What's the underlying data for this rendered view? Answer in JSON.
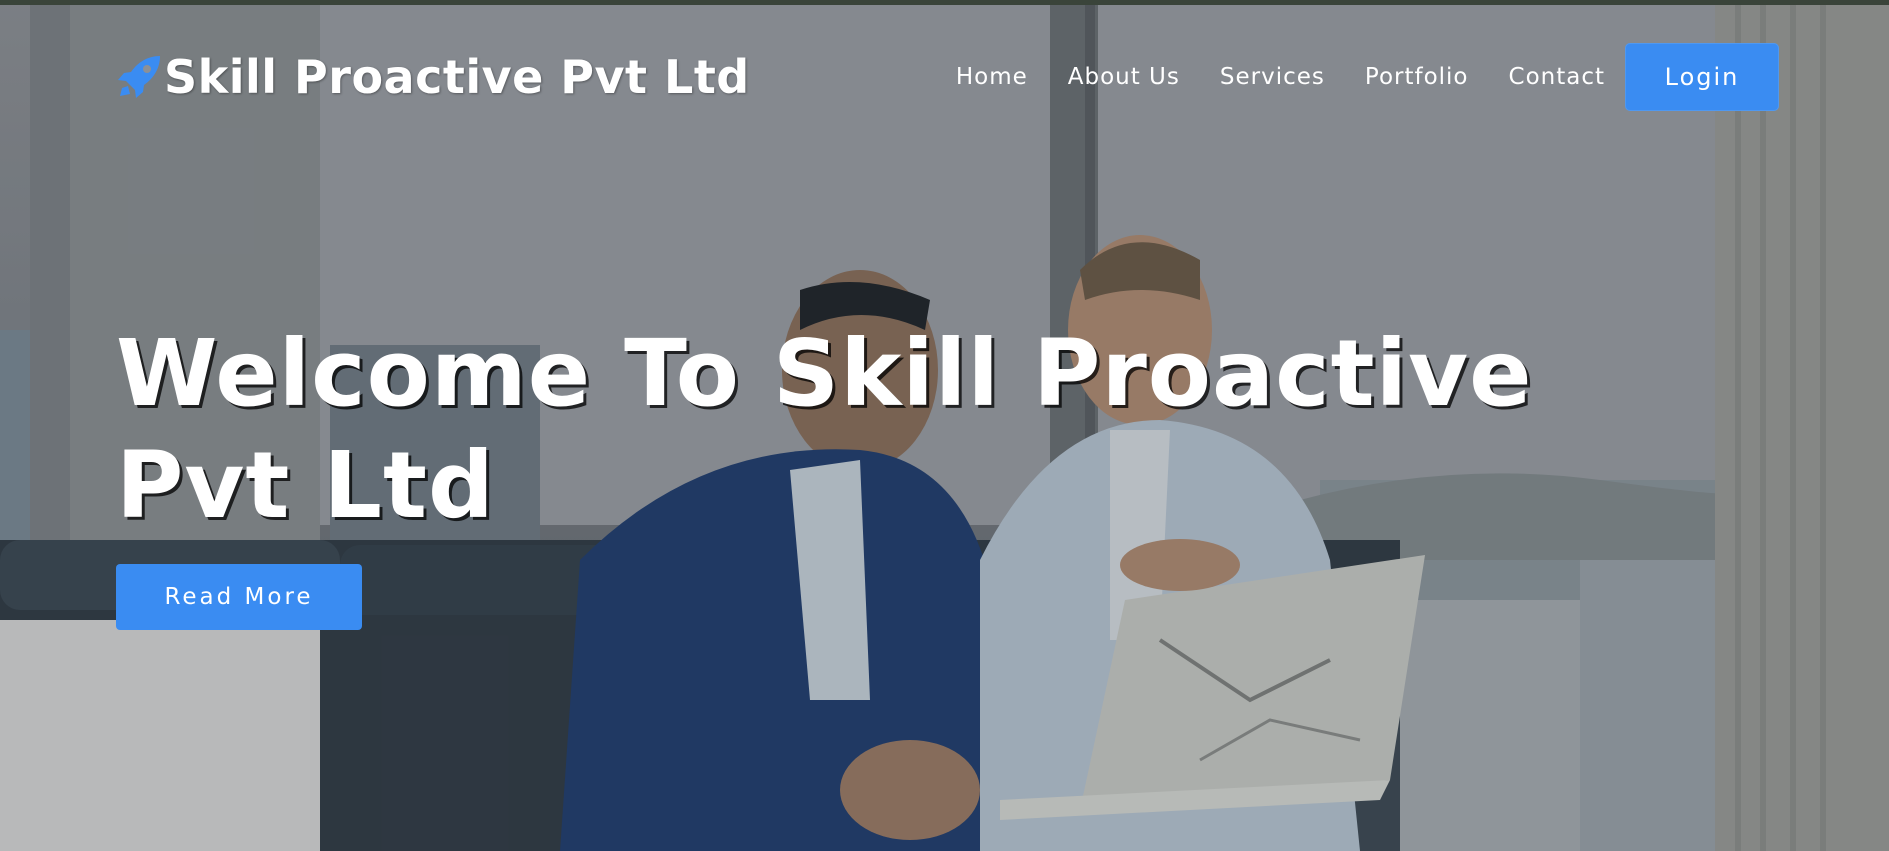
{
  "navbar": {
    "brand_icon": "rocket-icon",
    "brand_name": "Skill Proactive Pvt Ltd",
    "links": [
      {
        "label": "Home"
      },
      {
        "label": "About Us"
      },
      {
        "label": "Services"
      },
      {
        "label": "Portfolio"
      },
      {
        "label": "Contact"
      }
    ],
    "login_label": "Login"
  },
  "hero": {
    "title": "Welcome To Skill Proactive Pvt Ltd",
    "cta_label": "Read More",
    "background_image": "two-businessmen-laptop-office-photo"
  },
  "colors": {
    "accent": "#3a8cf2",
    "text": "#ffffff"
  }
}
